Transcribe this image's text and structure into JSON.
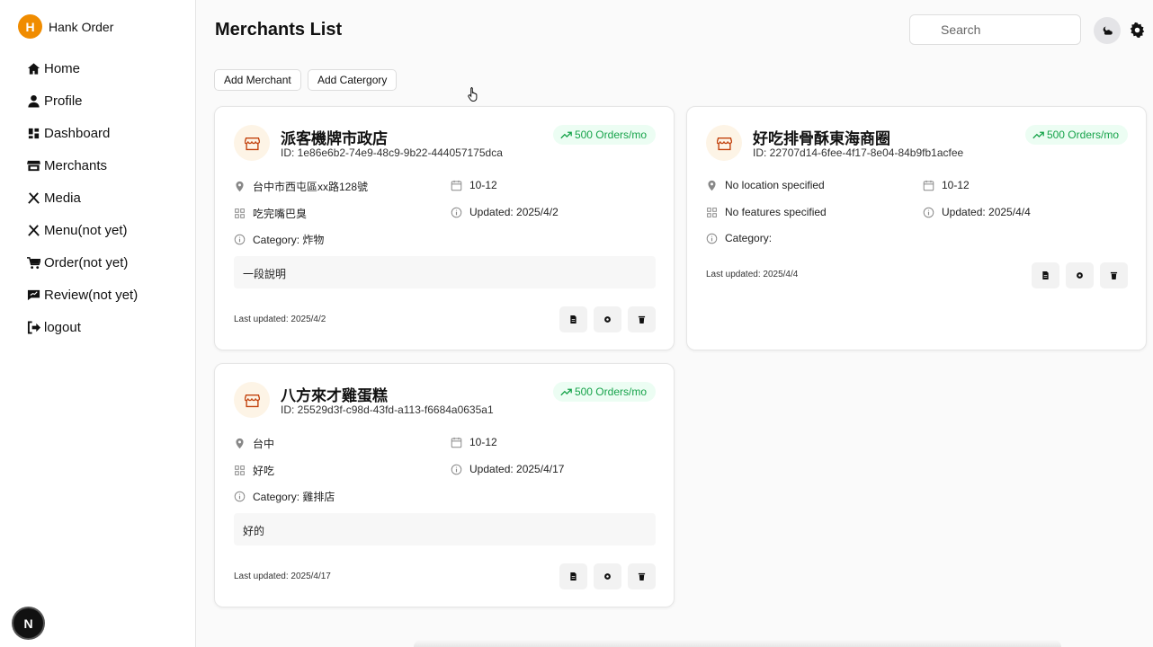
{
  "sidebar": {
    "brand_initial": "H",
    "brand_name": "Hank Order",
    "items": [
      {
        "label": "Home",
        "icon": "home-icon"
      },
      {
        "label": "Profile",
        "icon": "user-icon"
      },
      {
        "label": "Dashboard",
        "icon": "dashboard-icon"
      },
      {
        "label": "Merchants",
        "icon": "store-icon"
      },
      {
        "label": "Media",
        "icon": "utensils-icon"
      },
      {
        "label": "Menu(not yet)",
        "icon": "utensils-icon"
      },
      {
        "label": "Order(not yet)",
        "icon": "cart-icon"
      },
      {
        "label": "Review(not yet)",
        "icon": "comment-icon"
      },
      {
        "label": "logout",
        "icon": "logout-icon"
      }
    ],
    "framework_badge": "N"
  },
  "header": {
    "title": "Merchants List",
    "search_placeholder": "Search"
  },
  "actions": {
    "add_merchant": "Add Merchant",
    "add_category": "Add Catergory"
  },
  "colors": {
    "brand": "#f08c00",
    "badge_text": "#16a34a",
    "badge_bg": "#ecfdf3",
    "store_icon": "#c2410c"
  },
  "merchants": [
    {
      "name": "派客機牌市政店",
      "id": "ID: 1e86e6b2-74e9-48c9-9b22-444057175dca",
      "orders": "500 Orders/mo",
      "location": "台中市西屯區xx路128號",
      "hours": "10-12",
      "features": "吃完嘴巴臭",
      "updated": "Updated: 2025/4/2",
      "category": "Category: 炸物",
      "description": "一段說明",
      "last_updated": "Last updated: 2025/4/2"
    },
    {
      "name": "好吃排骨酥東海商圈",
      "id": "ID: 22707d14-6fee-4f17-8e04-84b9fb1acfee",
      "orders": "500 Orders/mo",
      "location": "No location specified",
      "hours": "10-12",
      "features": "No features specified",
      "updated": "Updated: 2025/4/4",
      "category": "Category:",
      "description": "",
      "last_updated": "Last updated: 2025/4/4"
    },
    {
      "name": "八方來才雞蛋糕",
      "id": "ID: 25529d3f-c98d-43fd-a113-f6684a0635a1",
      "orders": "500 Orders/mo",
      "location": "台中",
      "hours": "10-12",
      "features": "好吃",
      "updated": "Updated: 2025/4/17",
      "category": "Category: 雞排店",
      "description": "好的",
      "last_updated": "Last updated: 2025/4/17"
    }
  ]
}
